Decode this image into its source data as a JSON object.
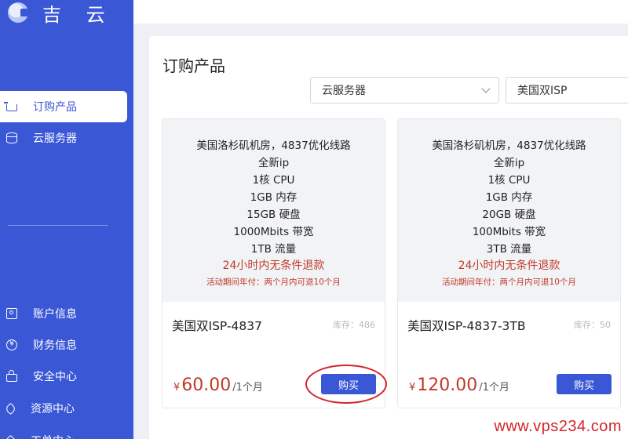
{
  "logo": {
    "text": "吉 云"
  },
  "sidebar": {
    "items": [
      {
        "label": "订购产品",
        "icon": "cart-icon",
        "active": true
      },
      {
        "label": "云服务器",
        "icon": "database-icon"
      },
      {
        "label": "账户信息",
        "icon": "user-card-icon"
      },
      {
        "label": "财务信息",
        "icon": "yen-icon"
      },
      {
        "label": "安全中心",
        "icon": "lock-icon"
      },
      {
        "label": "资源中心",
        "icon": "tag-icon"
      },
      {
        "label": "工单中心",
        "icon": "ticket-icon"
      }
    ]
  },
  "page": {
    "title": "订购产品"
  },
  "filters": {
    "category": "云服务器",
    "line": "美国双ISP"
  },
  "products": [
    {
      "specs": [
        "美国洛杉矶机房，4837优化线路",
        "全新ip",
        "1核 CPU",
        "1GB 内存",
        "15GB 硬盘",
        "1000Mbits 带宽",
        "1TB 流量"
      ],
      "refund": "24小时内无条件退款",
      "promo": "活动期间年付：两个月内可退10个月",
      "name": "美国双ISP-4837",
      "stock": "库存：486",
      "currency": "¥",
      "price": "60.00",
      "period": "/1个月",
      "buy_label": "购买"
    },
    {
      "specs": [
        "美国洛杉矶机房，4837优化线路",
        "全新ip",
        "1核 CPU",
        "1GB 内存",
        "20GB 硬盘",
        "100Mbits 带宽",
        "3TB 流量"
      ],
      "refund": "24小时内无条件退款",
      "promo": "活动期间年付：两个月内可退10个月",
      "name": "美国双ISP-4837-3TB",
      "stock": "库存：50",
      "currency": "¥",
      "price": "120.00",
      "period": "/1个月",
      "buy_label": "购买"
    }
  ],
  "watermark": "www.vps234.com",
  "colors": {
    "accent": "#3a57d6",
    "price": "#c0392b",
    "annotation": "#d2262b"
  }
}
